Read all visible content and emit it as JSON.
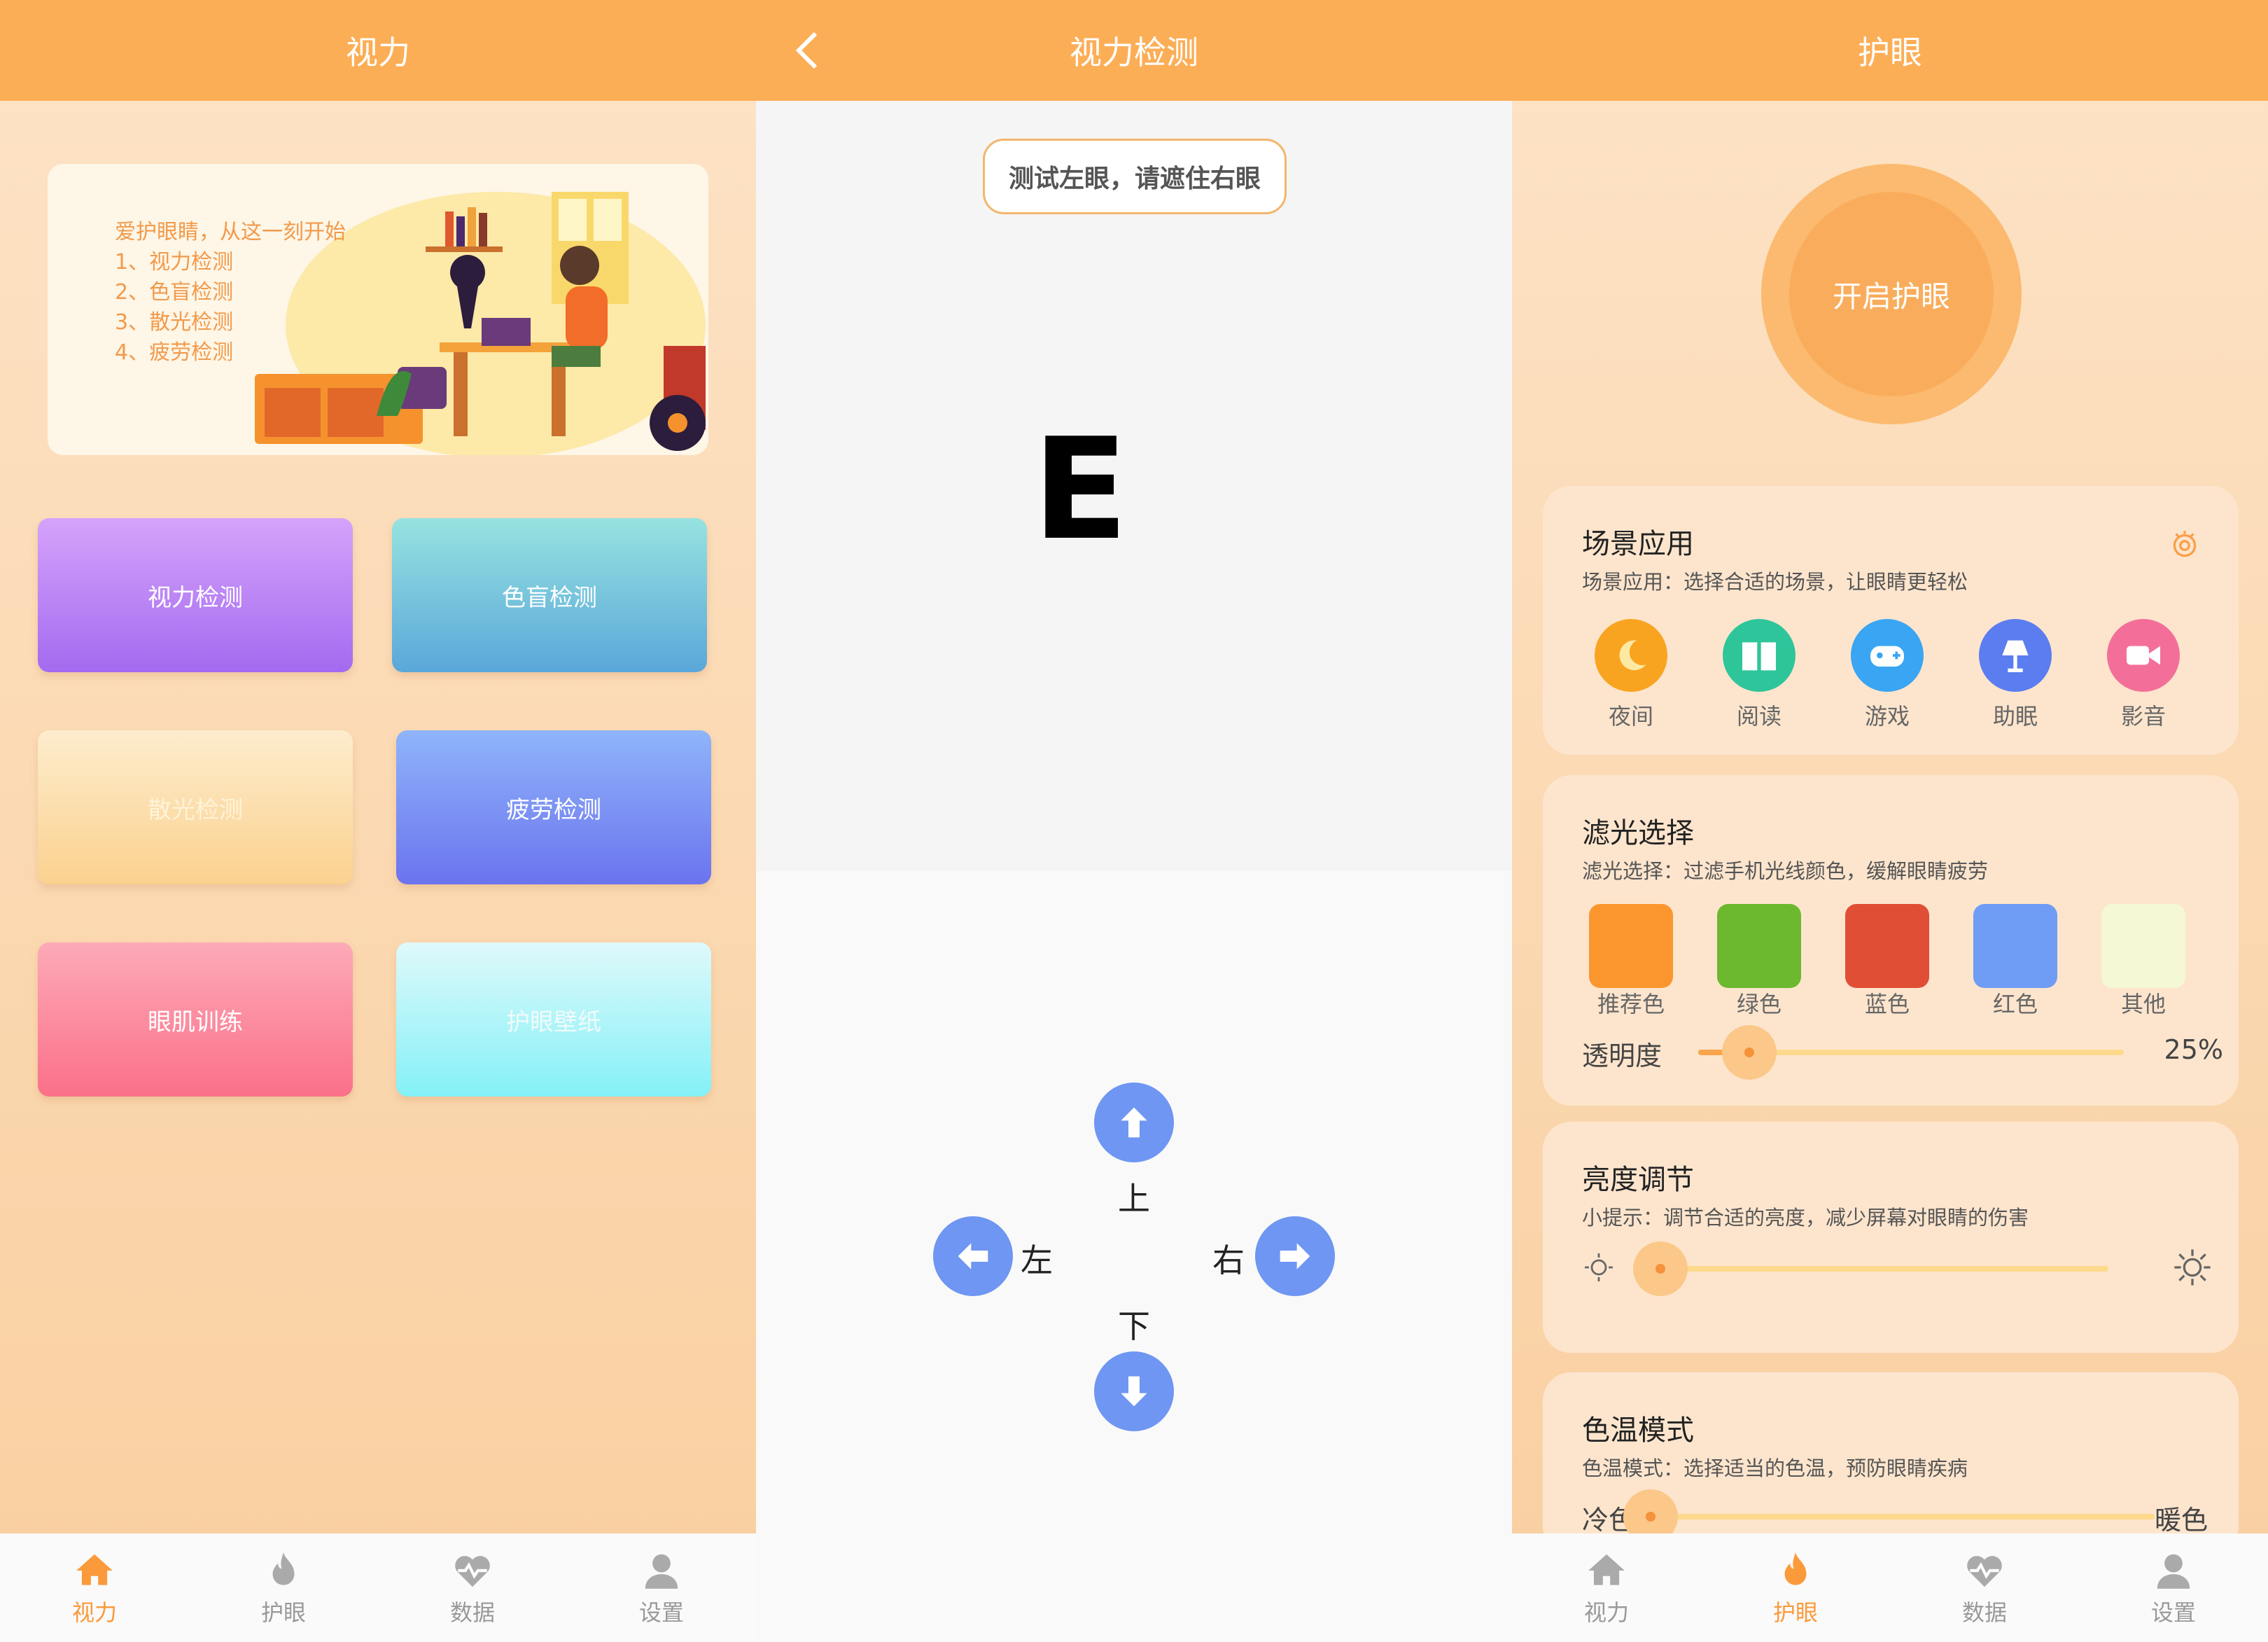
{
  "screen1": {
    "title": "视力",
    "banner_lines": [
      "爱护眼睛，从这一刻开始",
      "1、视力检测",
      "2、色盲检测",
      "3、散光检测",
      "4、疲劳检测"
    ],
    "buttons": [
      "视力检测",
      "色盲检测",
      "散光检测",
      "疲劳检测",
      "眼肌训练",
      "护眼壁纸"
    ]
  },
  "screen2": {
    "title": "视力检测",
    "hint": "测试左眼，请遮住右眼",
    "letter": "E",
    "up": "上",
    "down": "下",
    "left": "左",
    "right": "右"
  },
  "screen3": {
    "title": "护眼",
    "toggle_label": "开启护眼",
    "scene": {
      "title": "场景应用",
      "subtitle": "场景应用：选择合适的场景，让眼睛更轻松",
      "items": [
        "夜间",
        "阅读",
        "游戏",
        "助眠",
        "影音"
      ],
      "icons": [
        "moon-icon",
        "book-icon",
        "gamepad-icon",
        "lamp-icon",
        "video-icon"
      ]
    },
    "filter": {
      "title": "滤光选择",
      "subtitle": "滤光选择：过滤手机光线颜色，缓解眼睛疲劳",
      "options": [
        "推荐色",
        "绿色",
        "蓝色",
        "红色",
        "其他"
      ],
      "colors": [
        "#fb962f",
        "#6cb82e",
        "#e04e35",
        "#6f9cf5",
        "#f4f8d5"
      ],
      "opacity_label": "透明度",
      "opacity_value": "25%",
      "opacity_fraction": 0.25
    },
    "brightness": {
      "title": "亮度调节",
      "subtitle": "小提示：调节合适的亮度，减少屏幕对眼睛的伤害",
      "level": 0.0
    },
    "temperature": {
      "title": "色温模式",
      "subtitle": "色温模式：选择适当的色温，预防眼睛疾病",
      "cold_label": "冷色",
      "warm_label": "暖色",
      "level": 0.0
    }
  },
  "tabs": [
    "视力",
    "护眼",
    "数据",
    "设置"
  ],
  "tab_icons": [
    "home-icon",
    "flame-icon",
    "heartbeat-icon",
    "user-icon"
  ],
  "accent": "#fcae56",
  "active_tab_color": "#fb9a3a"
}
